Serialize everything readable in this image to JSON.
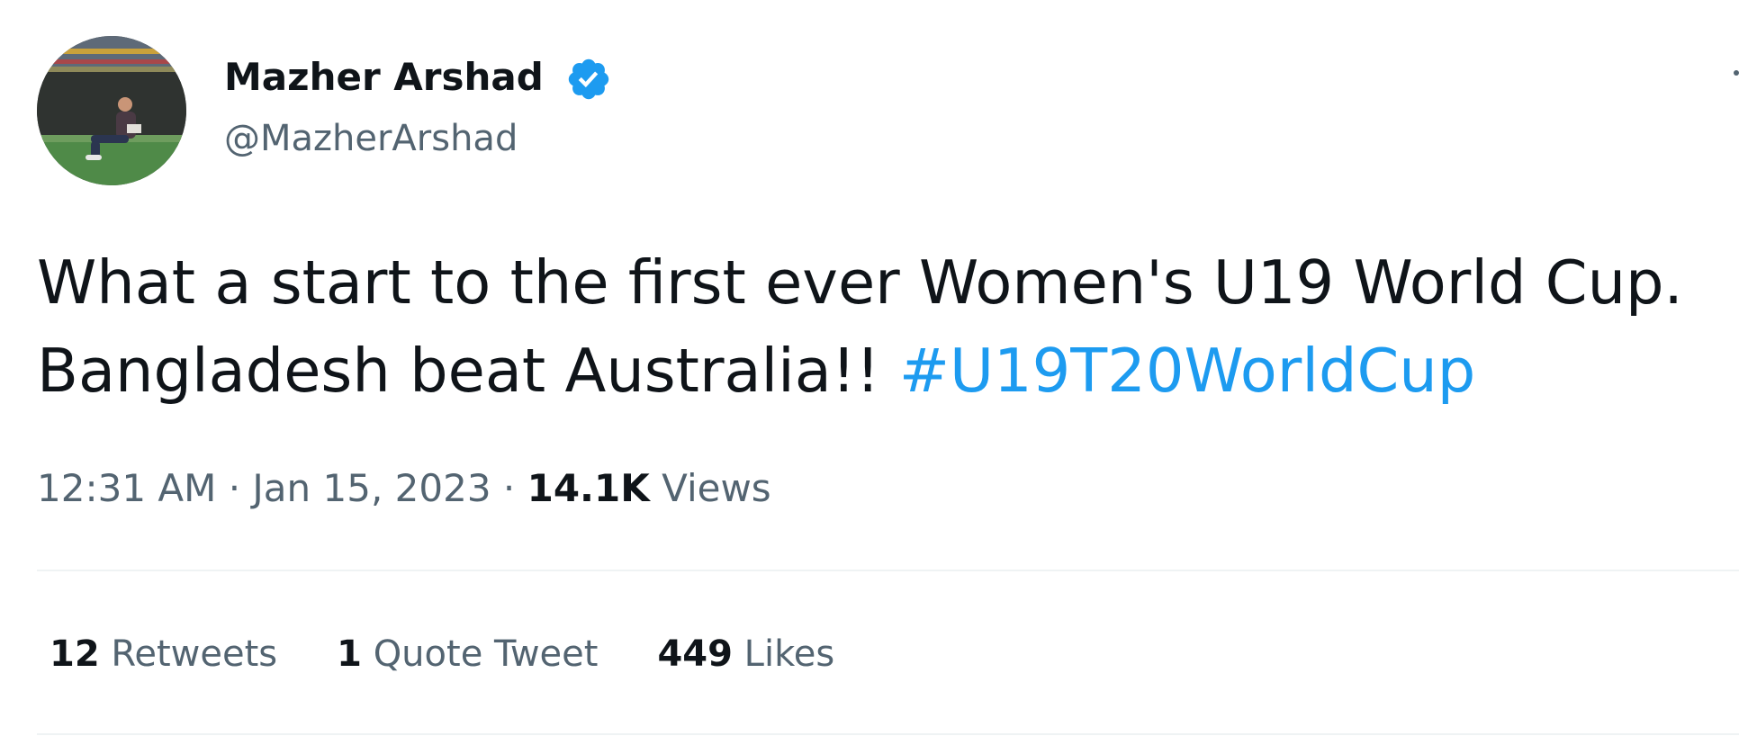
{
  "author": {
    "display_name": "Mazher Arshad",
    "handle": "@MazherArshad",
    "verified": true
  },
  "tweet": {
    "text_line1": "What a start to the first ever Women's U19 World Cup.",
    "text_line2_prefix": "Bangladesh beat Australia!! ",
    "hashtag": "#U19T20WorldCup"
  },
  "meta": {
    "time": "12:31 AM",
    "separator1": " · ",
    "date": "Jan 15, 2023",
    "separator2": " · ",
    "views_count": "14.1K",
    "views_label": " Views"
  },
  "stats": {
    "retweets_count": "12",
    "retweets_label": " Retweets",
    "quotes_count": "1",
    "quotes_label": " Quote Tweet",
    "likes_count": "449",
    "likes_label": " Likes"
  },
  "colors": {
    "text_primary": "#0f1419",
    "text_secondary": "#536471",
    "accent": "#1d9bf0",
    "divider": "#eff3f4"
  },
  "icons": {
    "verified": "verified-badge-icon",
    "more": "more-options-icon"
  }
}
